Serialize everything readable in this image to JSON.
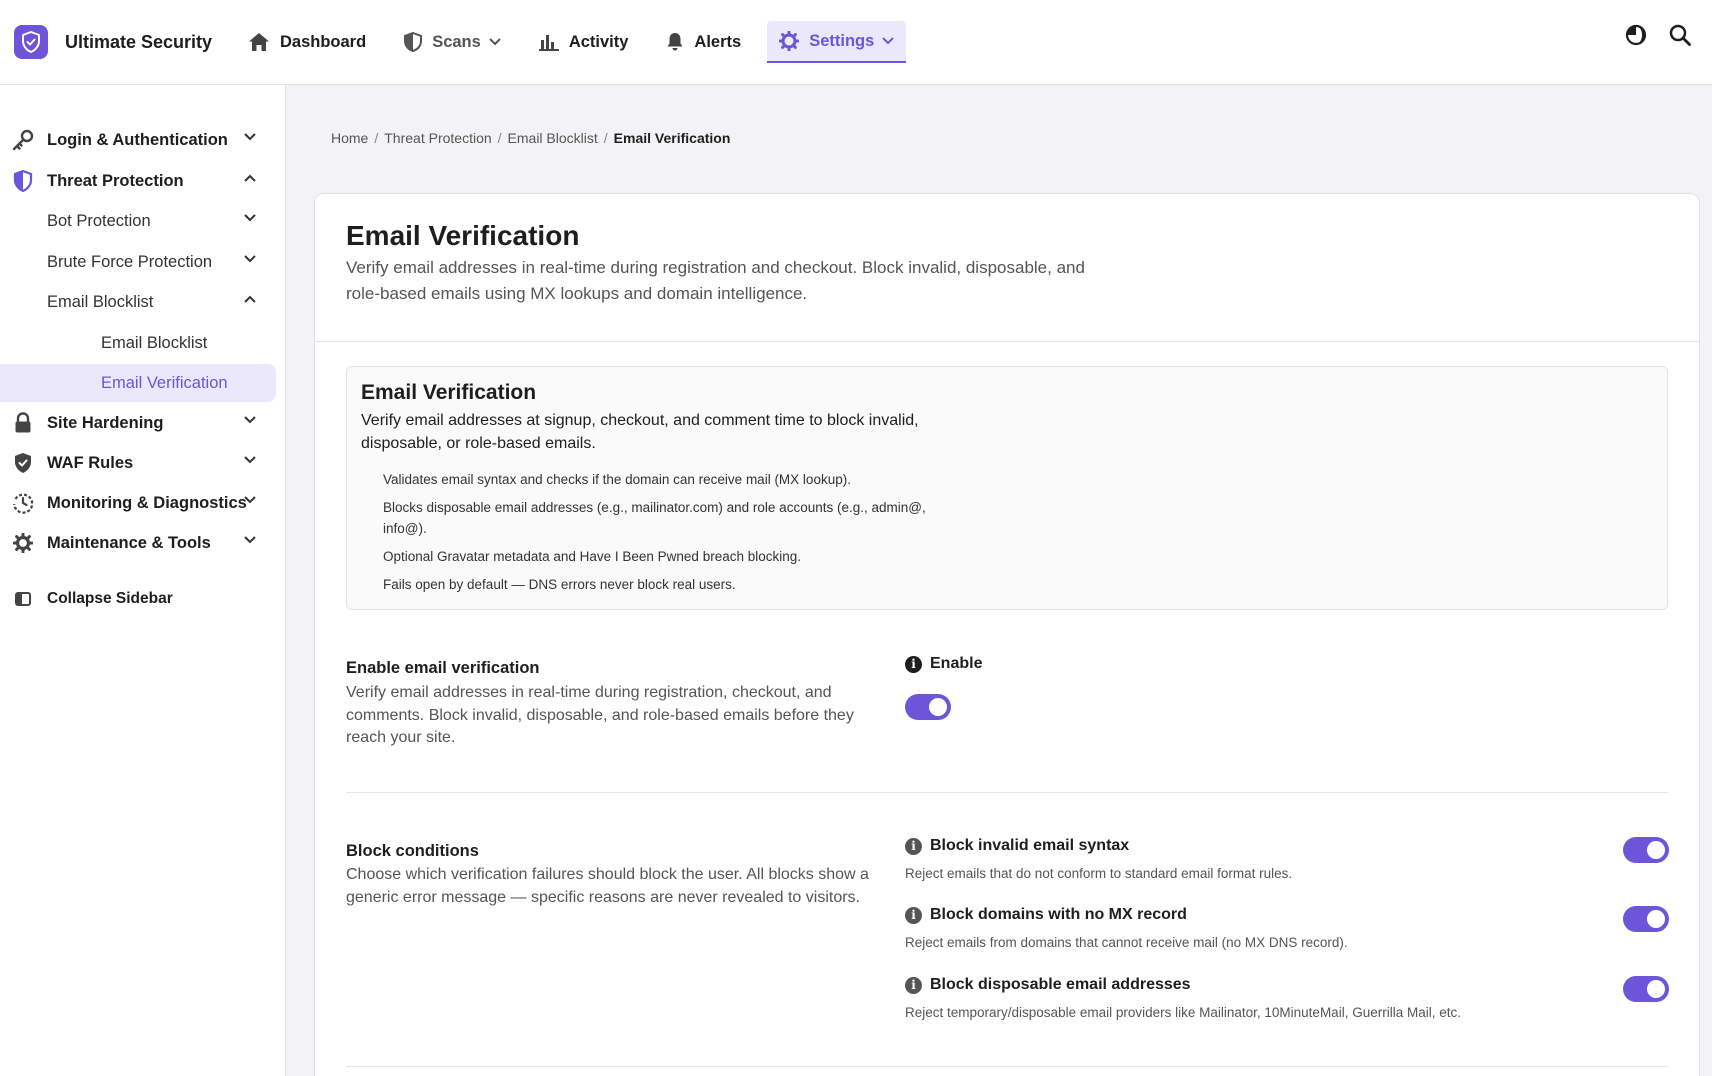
{
  "brand": {
    "name": "Ultimate Security",
    "logo_icon": "shield-check-icon",
    "accent": "#6c55d9"
  },
  "nav": {
    "items": [
      {
        "label": "Dashboard",
        "icon": "home-icon"
      },
      {
        "label": "Scans",
        "icon": "shield-icon"
      },
      {
        "label": "Activity",
        "icon": "bar-chart-icon"
      },
      {
        "label": "Alerts",
        "icon": "bell-icon"
      },
      {
        "label": "Settings",
        "icon": "gear-icon"
      }
    ],
    "active": "Settings",
    "right_icons": [
      "theme-toggle-icon",
      "search-icon"
    ]
  },
  "sidebar": {
    "items": [
      {
        "label": "Login & Authentication",
        "icon": "key-icon"
      },
      {
        "label": "Threat Protection",
        "icon": "shield-icon"
      },
      {
        "label": "Bot Protection"
      },
      {
        "label": "Brute Force Protection"
      },
      {
        "label": "Email Blocklist"
      },
      {
        "label": "Email Blocklist"
      },
      {
        "label": "Email Verification"
      },
      {
        "label": "Site Hardening",
        "icon": "lock-icon"
      },
      {
        "label": "WAF Rules",
        "icon": "shield-check-icon"
      },
      {
        "label": "Monitoring & Diagnostics",
        "icon": "history-icon"
      },
      {
        "label": "Maintenance & Tools",
        "icon": "gear-icon"
      }
    ],
    "selected": "Email Verification",
    "collapse_label": "Collapse Sidebar"
  },
  "breadcrumb": {
    "items": [
      "Home",
      "Threat Protection",
      "Email Blocklist"
    ],
    "current": "Email Verification",
    "separator": "/"
  },
  "page": {
    "title": "Email Verification",
    "description": "Verify email addresses in real-time during registration and checkout. Block invalid, disposable, and role-based emails using MX lookups and domain intelligence."
  },
  "info_box": {
    "title": "Email Verification",
    "description": "Verify email addresses at signup, checkout, and comment time to block invalid, disposable, or role-based emails.",
    "bullets": [
      "Validates email syntax and checks if the domain can receive mail (MX lookup).",
      "Blocks disposable email addresses (e.g., mailinator.com) and role accounts (e.g., admin@, info@).",
      "Optional Gravatar metadata and Have I Been Pwned breach blocking.",
      "Fails open by default — DNS errors never block real users."
    ]
  },
  "enable_section": {
    "label": "Enable email verification",
    "description": "Verify email addresses in real-time during registration, checkout, and comments. Block invalid, disposable, and role-based emails before they reach your site.",
    "option_label": "Enable",
    "enabled": true
  },
  "block_section": {
    "label": "Block conditions",
    "description": "Choose which verification failures should block the user. All blocks show a generic error message — specific reasons are never revealed to visitors.",
    "options": [
      {
        "label": "Block invalid email syntax",
        "description": "Reject emails that do not conform to standard email format rules.",
        "enabled": true
      },
      {
        "label": "Block domains with no MX record",
        "description": "Reject emails from domains that cannot receive mail (no MX DNS record).",
        "enabled": true
      },
      {
        "label": "Block disposable email addresses",
        "description": "Reject temporary/disposable email providers like Mailinator, 10MinuteMail, Guerrilla Mail, etc.",
        "enabled": true
      }
    ]
  }
}
